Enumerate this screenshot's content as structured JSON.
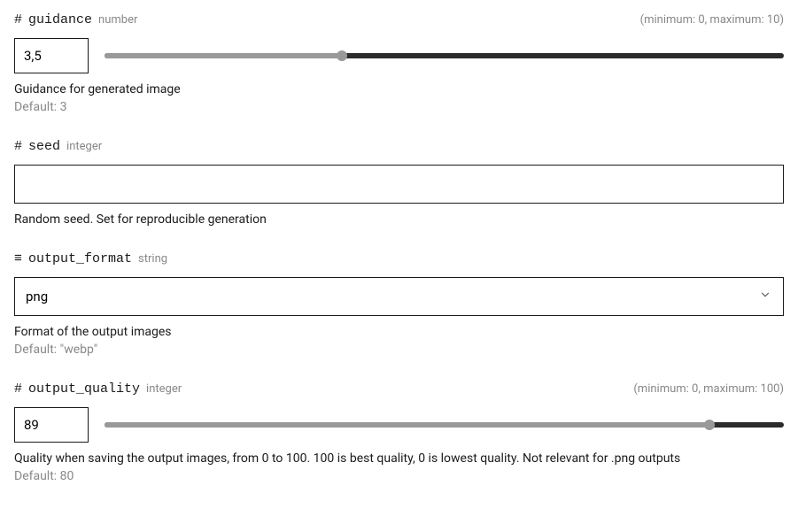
{
  "guidance": {
    "icon": "#",
    "name": "guidance",
    "type": "number",
    "range_hint": "(minimum: 0, maximum: 10)",
    "value": "3,5",
    "slider_percent": 35,
    "description": "Guidance for generated image",
    "default": "Default: 3"
  },
  "seed": {
    "icon": "#",
    "name": "seed",
    "type": "integer",
    "value": "",
    "description": "Random seed. Set for reproducible generation"
  },
  "output_format": {
    "icon": "≡",
    "name": "output_format",
    "type": "string",
    "value": "png",
    "description": "Format of the output images",
    "default": "Default: \"webp\""
  },
  "output_quality": {
    "icon": "#",
    "name": "output_quality",
    "type": "integer",
    "range_hint": "(minimum: 0, maximum: 100)",
    "value": "89",
    "slider_percent": 89,
    "description": "Quality when saving the output images, from 0 to 100. 100 is best quality, 0 is lowest quality. Not relevant for .png outputs",
    "default": "Default: 80"
  }
}
